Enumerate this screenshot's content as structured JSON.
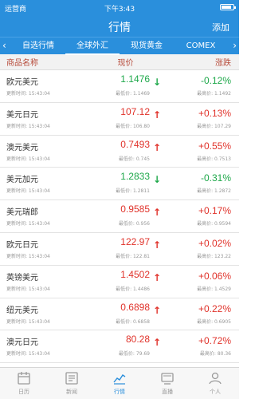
{
  "status_bar": {
    "carrier": "运营商",
    "time": "下午3:43",
    "battery_level": 0.85
  },
  "nav": {
    "title": "行情",
    "add_label": "添加"
  },
  "tabs": {
    "left_arrow": "‹",
    "right_arrow": "›",
    "items": [
      {
        "label": "自选行情",
        "active": false
      },
      {
        "label": "全球外汇",
        "active": true
      },
      {
        "label": "现货黄金",
        "active": false
      },
      {
        "label": "COMEX",
        "active": false
      }
    ]
  },
  "columns": {
    "name": "商品名称",
    "price": "现价",
    "change": "涨跌"
  },
  "rows": [
    {
      "name": "欧元美元",
      "update": "更新时间: 15:43:04",
      "price": "1.1476",
      "low": "最低价: 1.1469",
      "change": "-0.12%",
      "high": "最高价: 1.1492",
      "direction": "down"
    },
    {
      "name": "美元日元",
      "update": "更新时间: 15:43:04",
      "price": "107.12",
      "low": "最低价: 106.80",
      "change": "+0.13%",
      "high": "最高价: 107.29",
      "direction": "up"
    },
    {
      "name": "澳元美元",
      "update": "更新时间: 15:43:04",
      "price": "0.7493",
      "low": "最低价: 0.745",
      "change": "+0.55%",
      "high": "最高价: 0.7513",
      "direction": "up"
    },
    {
      "name": "美元加元",
      "update": "更新时间: 15:43:04",
      "price": "1.2833",
      "low": "最低价: 1.2811",
      "change": "-0.31%",
      "high": "最高价: 1.2872",
      "direction": "down"
    },
    {
      "name": "美元瑞郎",
      "update": "更新时间: 15:43:04",
      "price": "0.9585",
      "low": "最低价: 0.956",
      "change": "+0.17%",
      "high": "最高价: 0.9594",
      "direction": "up"
    },
    {
      "name": "欧元日元",
      "update": "更新时间: 15:43:04",
      "price": "122.97",
      "low": "最低价: 122.81",
      "change": "+0.02%",
      "high": "最高价: 123.22",
      "direction": "up"
    },
    {
      "name": "英镑美元",
      "update": "更新时间: 15:43:04",
      "price": "1.4502",
      "low": "最低价: 1.4486",
      "change": "+0.06%",
      "high": "最高价: 1.4529",
      "direction": "up"
    },
    {
      "name": "纽元美元",
      "update": "更新时间: 15:43:04",
      "price": "0.6898",
      "low": "最低价: 0.6858",
      "change": "+0.22%",
      "high": "最高价: 0.6905",
      "direction": "up"
    },
    {
      "name": "澳元日元",
      "update": "更新时间: 15:43:04",
      "price": "80.28",
      "low": "最低价: 79.69",
      "change": "+0.72%",
      "high": "最高价: 80.36",
      "direction": "up"
    }
  ],
  "arrows": {
    "up": "↑",
    "down": "↓"
  },
  "tabbar": [
    {
      "label": "日历",
      "icon": "calendar-icon",
      "active": false
    },
    {
      "label": "新闻",
      "icon": "news-icon",
      "active": false
    },
    {
      "label": "行情",
      "icon": "chart-icon",
      "active": true
    },
    {
      "label": "直播",
      "icon": "live-icon",
      "active": false
    },
    {
      "label": "个人",
      "icon": "person-icon",
      "active": false
    }
  ],
  "colors": {
    "primary": "#2a8fdc",
    "up": "#e0322a",
    "down": "#1ea84a",
    "header_text": "#b74b3a"
  }
}
